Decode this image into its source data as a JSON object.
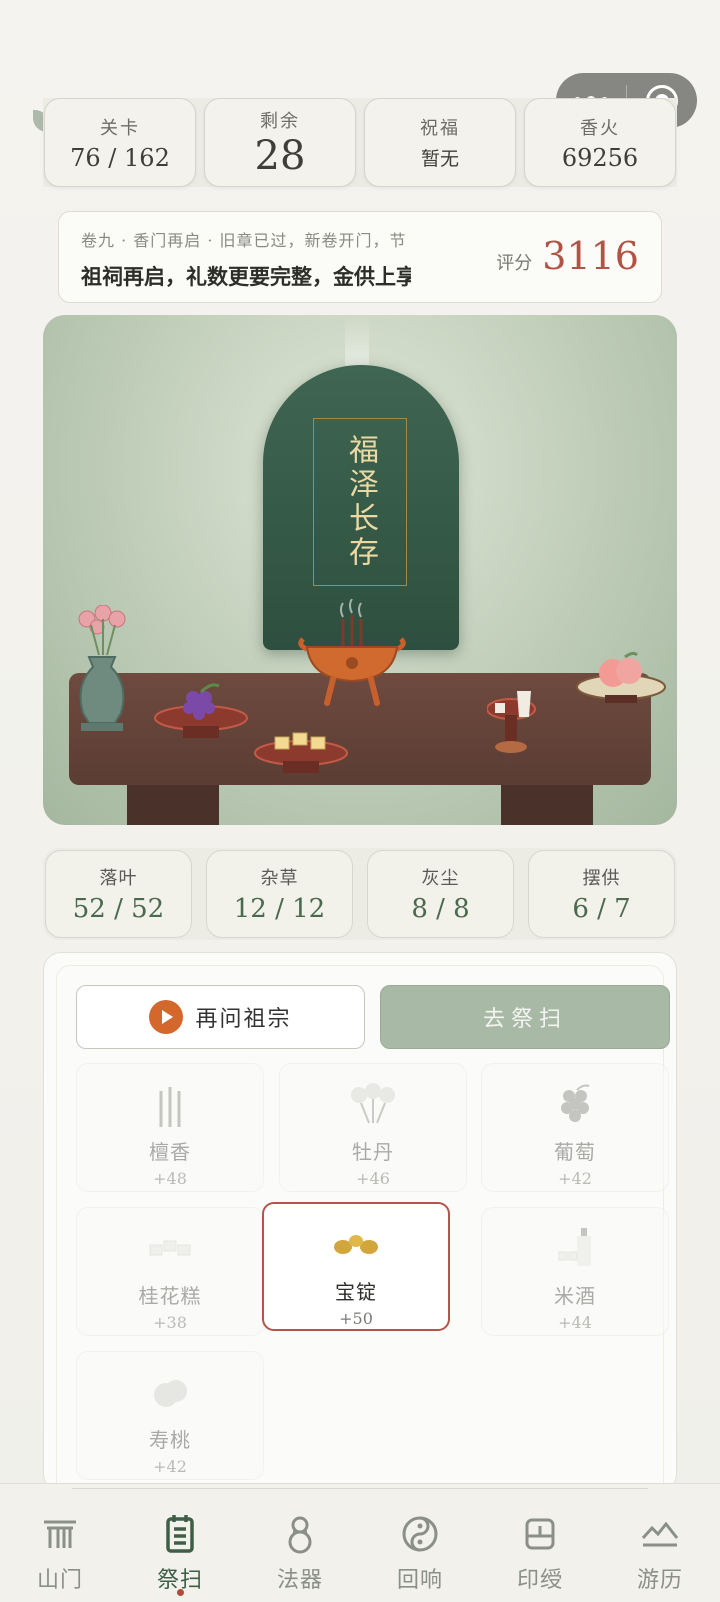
{
  "top_stats": [
    {
      "label": "关卡",
      "value": "76 / 162"
    },
    {
      "label": "剩余",
      "value": "28"
    },
    {
      "label": "祝福",
      "value": "暂无"
    },
    {
      "label": "香火",
      "value": "69256"
    }
  ],
  "banner": {
    "subtitle": "卷九 · 香门再启 · 旧章已过，新卷开门，节",
    "message": "祖祠再启，礼数更要完整，金供上享",
    "score_label": "评分",
    "score_value": "3116"
  },
  "altar": {
    "tablet_text": "福泽长存"
  },
  "clean_stats": [
    {
      "label": "落叶",
      "value": "52 / 52"
    },
    {
      "label": "杂草",
      "value": "12 / 12"
    },
    {
      "label": "灰尘",
      "value": "8 / 8"
    },
    {
      "label": "摆供",
      "value": "6 / 7"
    }
  ],
  "actions": {
    "ask_label": "再问祖宗",
    "go_label": "去祭扫"
  },
  "offerings": [
    {
      "name": "檀香",
      "points": "+48",
      "icon": "incense-icon"
    },
    {
      "name": "牡丹",
      "points": "+46",
      "icon": "peony-icon"
    },
    {
      "name": "葡萄",
      "points": "+42",
      "icon": "grape-icon"
    },
    {
      "name": "桂花糕",
      "points": "+38",
      "icon": "osmanthus-cake-icon"
    },
    {
      "name": "宝锭",
      "points": "+50",
      "icon": "gold-ingot-icon",
      "selected": true
    },
    {
      "name": "米酒",
      "points": "+44",
      "icon": "rice-wine-icon"
    },
    {
      "name": "寿桃",
      "points": "+42",
      "icon": "longevity-peach-icon"
    }
  ],
  "tabs": [
    {
      "label": "山门",
      "icon": "gate-icon"
    },
    {
      "label": "祭扫",
      "icon": "sweep-icon",
      "active": true
    },
    {
      "label": "法器",
      "icon": "gourd-icon"
    },
    {
      "label": "回响",
      "icon": "yinyang-icon"
    },
    {
      "label": "印绶",
      "icon": "seal-icon"
    },
    {
      "label": "游历",
      "icon": "mountain-icon"
    }
  ],
  "colors": {
    "accent_red": "#b35243",
    "tablet_green": "#2e4f3f",
    "button_green": "#a8b9a6",
    "selected_border": "#b5544a",
    "play_orange": "#d4672c"
  }
}
